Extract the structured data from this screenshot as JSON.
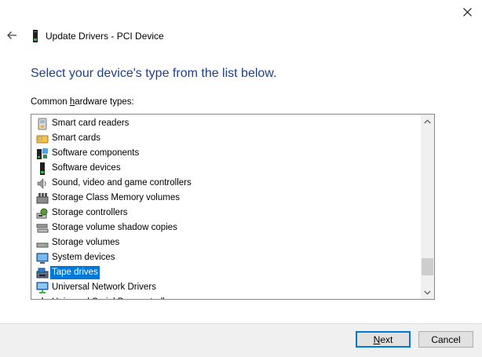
{
  "window": {
    "title": "Update Drivers - PCI Device",
    "close_icon": "close-icon",
    "back_icon": "back-arrow-icon"
  },
  "main": {
    "heading": "Select your device's type from the list below.",
    "list_label_prefix": "Common ",
    "list_label_accel": "h",
    "list_label_suffix": "ardware types:"
  },
  "device_list": {
    "selected_index": 10,
    "selection_color": "#0078d7",
    "items": [
      {
        "label": "Smart card readers",
        "icon": "smart-card-reader-icon"
      },
      {
        "label": "Smart cards",
        "icon": "smart-card-icon"
      },
      {
        "label": "Software components",
        "icon": "software-component-icon"
      },
      {
        "label": "Software devices",
        "icon": "software-device-icon"
      },
      {
        "label": "Sound, video and game controllers",
        "icon": "speaker-icon"
      },
      {
        "label": "Storage Class Memory volumes",
        "icon": "memory-volume-icon"
      },
      {
        "label": "Storage controllers",
        "icon": "storage-controller-icon"
      },
      {
        "label": "Storage volume shadow copies",
        "icon": "shadow-copy-icon"
      },
      {
        "label": "Storage volumes",
        "icon": "storage-volume-icon"
      },
      {
        "label": "System devices",
        "icon": "system-device-icon"
      },
      {
        "label": "Tape drives",
        "icon": "tape-drive-icon"
      },
      {
        "label": "Universal Network Drivers",
        "icon": "network-driver-icon"
      },
      {
        "label": "Universal Serial Bus controllers",
        "icon": "usb-controller-icon"
      }
    ]
  },
  "footer": {
    "next_accel": "N",
    "next_rest": "ext",
    "cancel_label": "Cancel"
  },
  "colors": {
    "heading": "#1e3f8a",
    "footer_bg": "#f0f0f0",
    "accent": "#0078d7"
  }
}
